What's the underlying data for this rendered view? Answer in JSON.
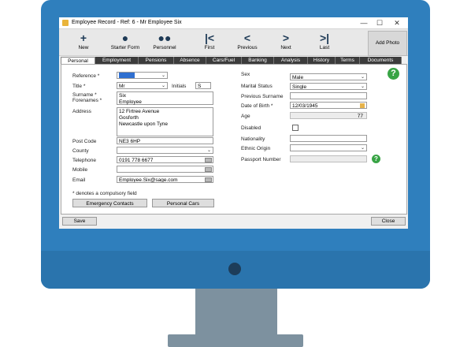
{
  "window": {
    "title": "Employee Record - Ref: 6 - Mr Employee Six",
    "minimize": "—",
    "maximize": "☐",
    "close": "✕"
  },
  "toolbar": {
    "new": "New",
    "starter_form": "Starter Form",
    "personnel": "Personnel",
    "first": "First",
    "previous": "Previous",
    "next": "Next",
    "last": "Last",
    "add_photo": "Add Photo"
  },
  "tabs": [
    "Personal",
    "Employment",
    "Pensions",
    "Absence",
    "Cars/Fuel",
    "Banking",
    "Analysis",
    "History",
    "Terms",
    "Documents"
  ],
  "form": {
    "reference_label": "Reference *",
    "reference_value": "",
    "title_label": "Title *",
    "title_value": "Mr",
    "initials_label": "Initials",
    "initials_value": "S",
    "surname_label": "Surname *",
    "forenames_label": "Forenames *",
    "surname_value": "Six",
    "forenames_value": "Employee",
    "address_label": "Address",
    "address_lines": [
      "12 Firtree Avenue",
      "Gosforth",
      "Newcastle upon Tyne"
    ],
    "postcode_label": "Post Code",
    "postcode_value": "NE3 6HP",
    "county_label": "County",
    "county_value": "",
    "telephone_label": "Telephone",
    "telephone_value": "0191 778 6677",
    "mobile_label": "Mobile",
    "mobile_value": "",
    "email_label": "Email",
    "email_value": "Employee.Six@sage.com",
    "compulsory_note": "* denotes a compulsory field",
    "emergency_contacts": "Emergency Contacts",
    "personal_cars": "Personal Cars",
    "sex_label": "Sex",
    "sex_value": "Male",
    "marital_label": "Marital Status",
    "marital_value": "Single",
    "prev_surname_label": "Previous Surname",
    "prev_surname_value": "",
    "dob_label": "Date of Birth *",
    "dob_value": "12/03/1945",
    "age_label": "Age",
    "age_value": "77",
    "disabled_label": "Disabled",
    "nationality_label": "Nationality",
    "nationality_value": "",
    "ethnic_label": "Ethnic Origin",
    "ethnic_value": "",
    "passport_label": "Passport Number",
    "passport_value": ""
  },
  "footer": {
    "save": "Save",
    "close": "Close"
  }
}
